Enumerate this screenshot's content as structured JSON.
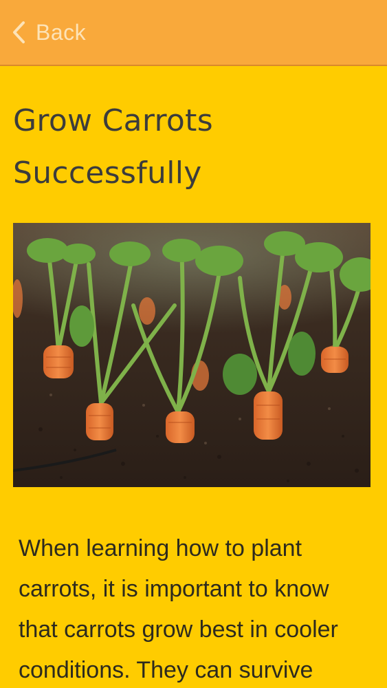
{
  "header": {
    "back_label": "Back",
    "back_icon": "chevron-left-icon",
    "bar_color": "#f9a93b"
  },
  "article": {
    "title": "Grow Carrots Successfully",
    "image_icon": "carrots-photo",
    "body": "When learning how to plant carrots, it is important to know that carrots grow best in cooler conditions. They can survive"
  },
  "colors": {
    "background": "#ffcc00",
    "title_text": "#3c3c3c",
    "body_text": "#2d2a1e"
  }
}
